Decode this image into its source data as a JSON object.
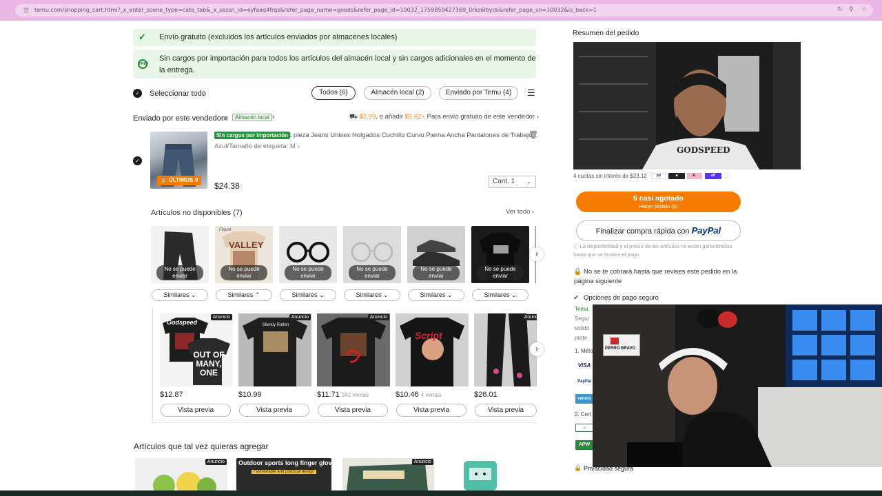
{
  "browser": {
    "url": "temu.com/shopping_cart.html?_x_enter_scene_type=cate_tab&_x_sessn_id=eyfaaq4frqs&refer_page_name=goods&refer_page_id=10032_1759859427369_0rks6lbycb&refer_page_sn=10032&is_back=1"
  },
  "banners": {
    "free_shipping": "Envío gratuito (excluidos los artículos enviados por almacenes locales)",
    "no_import_line1": "Sin cargos por importación para todos los artículos del almacén local y sin cargos adicionales en el momento de",
    "no_import_line2": "la entrega."
  },
  "selection": {
    "select_all": "Seleccionar todo",
    "filters": [
      "Todos (6)",
      "Almacén local (2)",
      "Enviado por Temu (4)"
    ]
  },
  "seller": {
    "label": "Enviado por este vendedor",
    "badge": "Almacén local",
    "shipping_price": "$2.99",
    "shipping_mid": ", o añadir",
    "shipping_add": "$5.62+",
    "shipping_tail": "Para envío gratuito de este vendedor"
  },
  "cart_item": {
    "tag": "Sin cargos por importación",
    "title": "1 pieza Jeans Unisex Holgados Cuchillo Curvo Pierna Ancha Pantalones de Trabajo...",
    "variant": "Azul/Tamaño de etiqueta: M",
    "stock_badge": "ÚLTIMOS 9",
    "price": "$24.38",
    "qty": "Cant. 1"
  },
  "unavailable": {
    "heading": "Artículos no disponibles (7)",
    "see_all": "Ver todo",
    "overlay": "No se puede enviar",
    "similar": "Similares",
    "thumb_text": [
      "Fepnd",
      "VALLEY"
    ]
  },
  "ads": {
    "tag": "Anuncio",
    "cta": "Vista previa",
    "shirt_text": [
      "Godspeed",
      "OUT OF MANY, ONE",
      "Sliently Rotten",
      "Script"
    ],
    "items": [
      {
        "price": "$12.87",
        "sales": ""
      },
      {
        "price": "$10.99",
        "sales": ""
      },
      {
        "price": "$11.71",
        "sales": "242 ventas"
      },
      {
        "price": "$10.46",
        "sales": "4 ventas"
      },
      {
        "price": "$26.01",
        "sales": ""
      }
    ]
  },
  "suggestions": {
    "heading": "Artículos que tal vez quieras agregar",
    "gloves_title": "Outdoor sports long finger gloves",
    "gloves_sub": "Fashionable and practical design"
  },
  "summary": {
    "heading": "Resumen del pedido",
    "installments": "4 cuotas sin interés de $23.12",
    "checkout_label": "5 casi agotado",
    "checkout_sub": "Hacer pedido (6)",
    "paypal_prefix": "Finalizar compra rápida con",
    "paypal_brand": "PayPal",
    "disclaimer_line1": "La disponibilidad y el precio de los artículos no están garantizados",
    "disclaimer_line2": "hasta que se finalice el pago.",
    "charge_note_line1": "No se te cobrará hasta que revises este pedido en la",
    "charge_note_line2": "página siguiente",
    "secure_pay": "Opciones de pago seguro",
    "partial_left": [
      "Temu",
      "Segur",
      "sólido",
      "prote",
      "1. Méto",
      "2. Cert"
    ],
    "privacy": "Privacidad segura",
    "pay_methods": [
      "VISA",
      "PayPal",
      "venmo",
      "APW"
    ]
  },
  "streamer": {
    "sign_text": "PERRO BRAVO",
    "shirt_text": "GODSPEED"
  },
  "colors": {
    "accent_orange": "#f57c00",
    "banner_green": "#e8f6e8",
    "check_green": "#1f8a2e",
    "browser_pink": "#e9b6e5"
  }
}
